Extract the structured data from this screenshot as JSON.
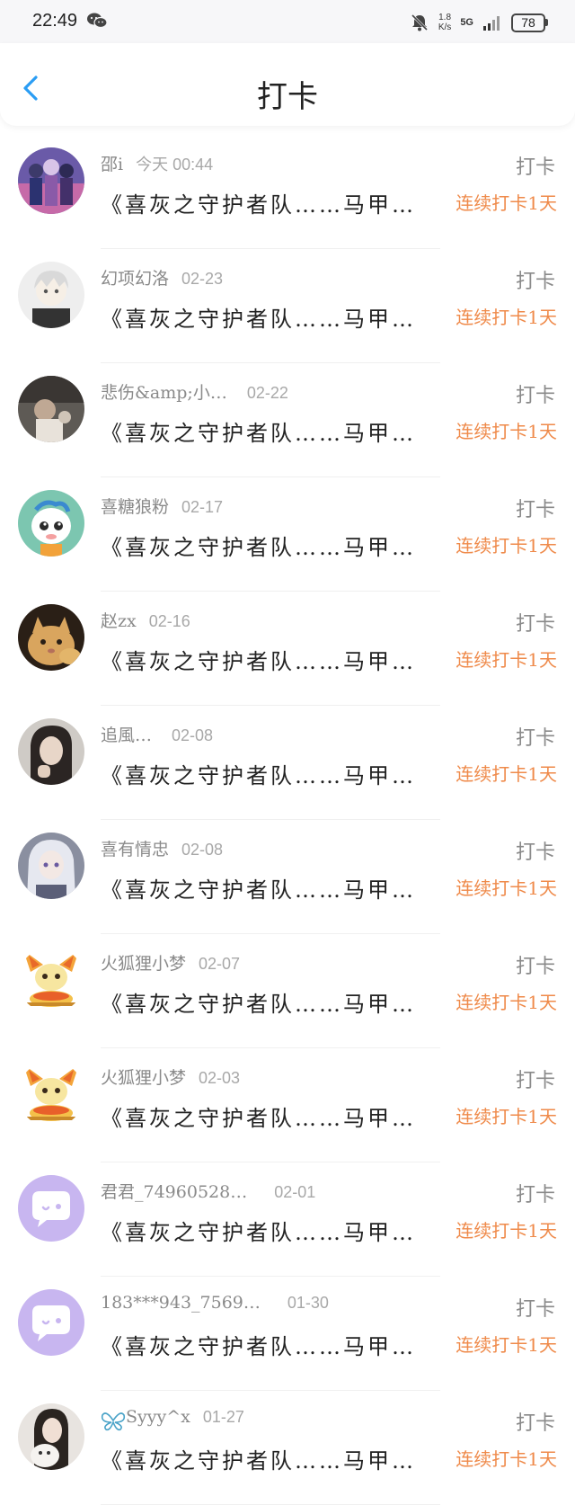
{
  "status_bar": {
    "time": "22:49",
    "net_speed_value": "1.8",
    "net_speed_unit": "K/s",
    "network": "5G",
    "battery": "78"
  },
  "header": {
    "title": "打卡"
  },
  "list": {
    "action_label": "打卡",
    "post_title": "《喜灰之守护者队……马甲…",
    "streak": "连续打卡1天",
    "items": [
      {
        "name": "邵i",
        "date": "今天 00:44",
        "avatar": "anime-group-avatar"
      },
      {
        "name": "幻项幻洛",
        "date": "02-23",
        "avatar": "white-hair-anime-avatar"
      },
      {
        "name": "悲伤&amp;小…",
        "date": "02-22",
        "avatar": "photo-avatar"
      },
      {
        "name": "喜糖狼粉",
        "date": "02-17",
        "avatar": "cartoon-goat-avatar"
      },
      {
        "name": "赵zx",
        "date": "02-16",
        "avatar": "cat-avatar"
      },
      {
        "name": "追風…",
        "date": "02-08",
        "avatar": "girl-photo-avatar"
      },
      {
        "name": "喜有情忠",
        "date": "02-08",
        "avatar": "anime-girl-avatar"
      },
      {
        "name": "火狐狸小梦",
        "date": "02-07",
        "avatar": "fennekin-avatar"
      },
      {
        "name": "火狐狸小梦",
        "date": "02-03",
        "avatar": "fennekin-avatar"
      },
      {
        "name": "君君_74960528…",
        "date": "02-01",
        "avatar": "default-chat-avatar"
      },
      {
        "name": "183***943_7569…",
        "date": "01-30",
        "avatar": "default-chat-avatar"
      },
      {
        "name": "Syyy^x",
        "date": "01-27",
        "avatar": "girl-cat-photo-avatar"
      }
    ]
  }
}
